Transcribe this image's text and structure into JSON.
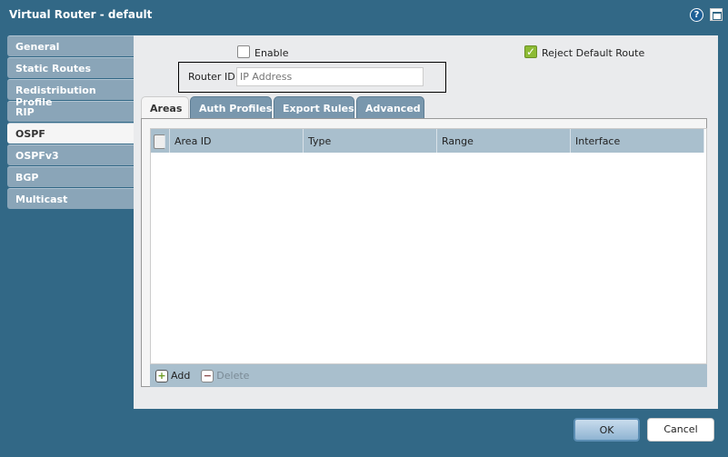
{
  "window": {
    "title": "Virtual Router - default"
  },
  "sidebar": {
    "items": [
      {
        "label": "General"
      },
      {
        "label": "Static Routes"
      },
      {
        "label": "Redistribution Profile"
      },
      {
        "label": "RIP"
      },
      {
        "label": "OSPF",
        "active": true
      },
      {
        "label": "OSPFv3"
      },
      {
        "label": "BGP"
      },
      {
        "label": "Multicast"
      }
    ]
  },
  "form": {
    "enable_label": "Enable",
    "enable_checked": false,
    "reject_label": "Reject Default Route",
    "reject_checked": true,
    "router_id_label": "Router ID",
    "router_id_placeholder": "IP Address",
    "router_id_value": ""
  },
  "tabs": [
    {
      "label": "Areas"
    },
    {
      "label": "Auth Profiles"
    },
    {
      "label": "Export Rules"
    },
    {
      "label": "Advanced"
    }
  ],
  "table": {
    "columns": [
      "Area ID",
      "Type",
      "Range",
      "Interface"
    ],
    "rows": []
  },
  "toolbar": {
    "add": "Add",
    "delete": "Delete"
  },
  "buttons": {
    "ok": "OK",
    "cancel": "Cancel"
  }
}
